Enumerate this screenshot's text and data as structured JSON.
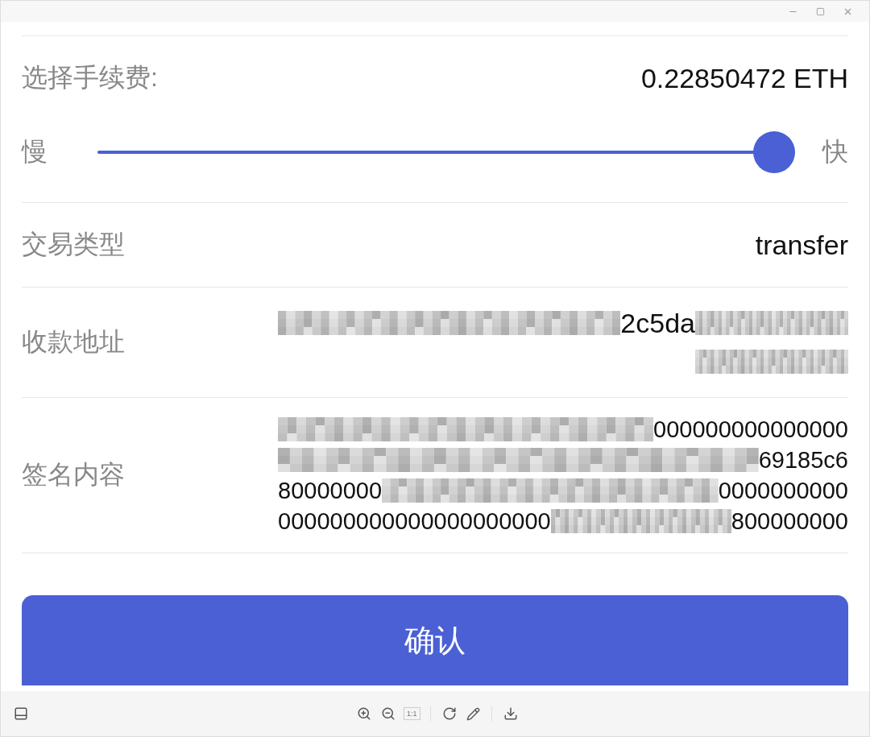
{
  "fee": {
    "label": "选择手续费:",
    "value": "0.22850472 ETH",
    "slow": "慢",
    "fast": "快",
    "level": 1
  },
  "rows": [
    {
      "kind": "text",
      "label": "交易类型",
      "value": "transfer"
    },
    {
      "kind": "lines",
      "label": "收款地址",
      "lines": [
        [
          {
            "kind": "mosaic"
          },
          {
            "kind": "text",
            "text": "2c5da"
          },
          {
            "kind": "mosaic",
            "short": true
          }
        ],
        [
          {
            "kind": "mosaic",
            "short": true
          }
        ]
      ]
    },
    {
      "kind": "lines",
      "label": "签名内容",
      "lines": [
        [
          {
            "kind": "mosaic"
          },
          {
            "kind": "text",
            "text": "000000000000000"
          }
        ],
        [
          {
            "kind": "mosaic"
          },
          {
            "kind": "text",
            "text": "69185c6"
          }
        ],
        [
          {
            "kind": "text",
            "text": "80000000"
          },
          {
            "kind": "mosaic"
          },
          {
            "kind": "text",
            "text": "0000000000"
          }
        ],
        [
          {
            "kind": "text",
            "text": "000000000000000000000"
          },
          {
            "kind": "mosaic"
          },
          {
            "kind": "text",
            "text": "800000000"
          }
        ]
      ]
    }
  ],
  "confirm": "确认",
  "toolbar": {
    "actual_size": "1:1",
    "actual_size_disabled": true
  }
}
